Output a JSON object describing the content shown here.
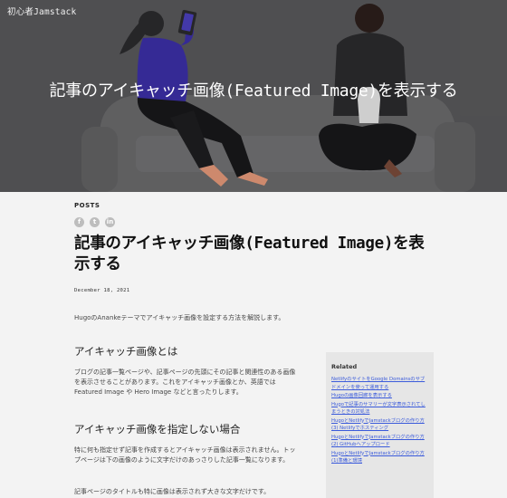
{
  "site": {
    "title": "初心者Jamstack"
  },
  "hero": {
    "title": "記事のアイキャッチ画像(Featured Image)を表示する"
  },
  "article": {
    "section": "POSTS",
    "share_icons": [
      "facebook-icon",
      "twitter-icon",
      "linkedin-icon"
    ],
    "share_glyphs": {
      "facebook": "f",
      "twitter": "t",
      "linkedin": "in"
    },
    "title": "記事のアイキャッチ画像(Featured Image)を表示する",
    "date": "December 18, 2021",
    "intro": "HugoのAnankeテーマでアイキャッチ画像を設定する方法を解説します。",
    "h_featured": "アイキャッチ画像とは",
    "p_featured": "ブログの記事一覧ページや、記事ページの先頭にその記事と関連性のある画像を表示させることがあります。これをアイキャッチ画像とか、英語では Featured Image や Hero Image などと言ったりします。",
    "h_none": "アイキャッチ画像を指定しない場合",
    "p_none": "特に何も指定せず記事を作成するとアイキャッチ画像は表示されません。トップページは下の画像のように文字だけのあっさりした記事一覧になります。",
    "p_title": "記事ページのタイトルも特に画像は表示されず大きな文字だけです。"
  },
  "related": {
    "title": "Related",
    "links": [
      "NetlifyのサイトをGoogle Domainsのサブドメインを使って運用する",
      "Hugoの画像回廊を表示する",
      "Hugoで記事のサマリーが文字表示されてしまうときの対処法",
      "HugoとNetlifyでJamstackブログの作り方 (3) Netlifyでホスティング",
      "HugoとNetlifyでJamstackブログの作り方 (2) GitHubへアップロード",
      "HugoとNetlifyでJamstackブログの作り方 (1)準備と環境"
    ]
  },
  "colors": {
    "hero_bg": "#58585a",
    "page_bg": "#f3f3f3",
    "related_bg": "#e6e6e6",
    "link": "#3b5bdb",
    "shirt": "#3b2ea8"
  }
}
